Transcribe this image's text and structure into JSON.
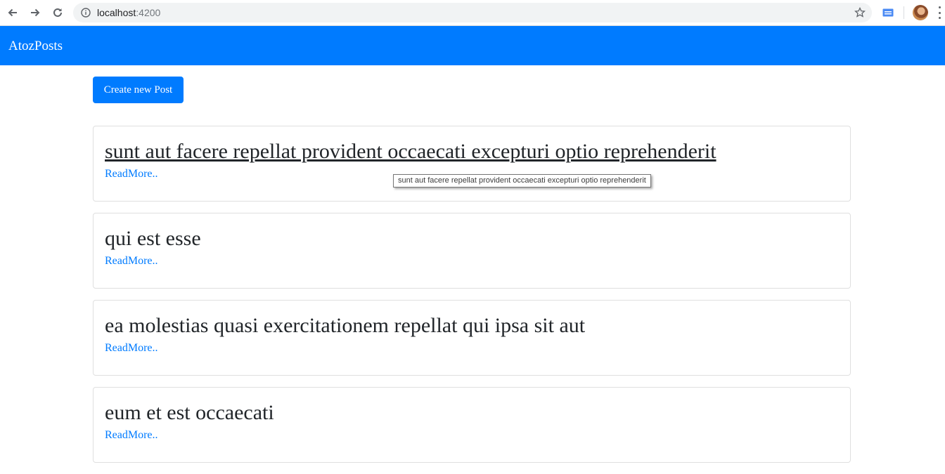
{
  "browser": {
    "url_host": "localhost",
    "url_port": ":4200"
  },
  "navbar": {
    "brand": "AtozPosts",
    "color": "#007bff"
  },
  "actions": {
    "create_label": "Create new Post"
  },
  "posts": [
    {
      "title": "sunt aut facere repellat provident occaecati excepturi optio reprehenderit",
      "readmore": "ReadMore.."
    },
    {
      "title": "qui est esse",
      "readmore": "ReadMore.."
    },
    {
      "title": "ea molestias quasi exercitationem repellat qui ipsa sit aut",
      "readmore": "ReadMore.."
    },
    {
      "title": "eum et est occaecati",
      "readmore": "ReadMore.."
    }
  ],
  "tooltip": {
    "text": "sunt aut facere repellat provident occaecati excepturi optio reprehenderit"
  }
}
